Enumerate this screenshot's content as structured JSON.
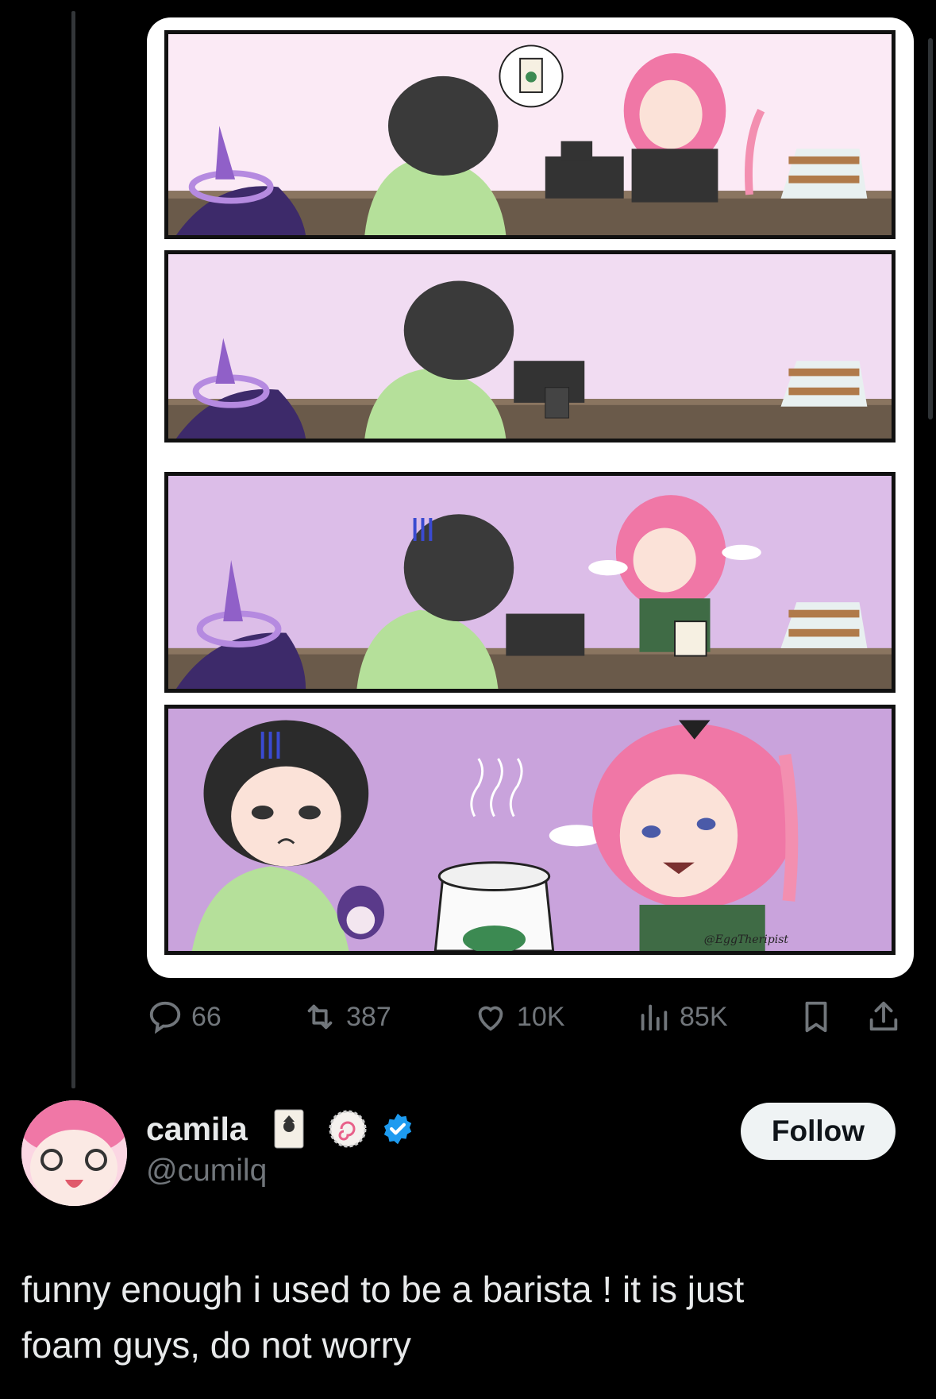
{
  "post": {
    "watermark": "@EggTheripist",
    "actions": {
      "replies": "66",
      "reposts": "387",
      "likes": "10K",
      "views": "85K"
    }
  },
  "user": {
    "display_name": "camila",
    "handle": "@cumilq",
    "follow_label": "Follow",
    "verified_color": "#1d9bf0"
  },
  "reply": {
    "text_line1": "funny enough i used to be a barista ! it is just",
    "text_line2": "foam guys, do not worry"
  },
  "colors": {
    "background": "#000000",
    "text": "#e7e9ea",
    "secondary": "#71767b"
  }
}
